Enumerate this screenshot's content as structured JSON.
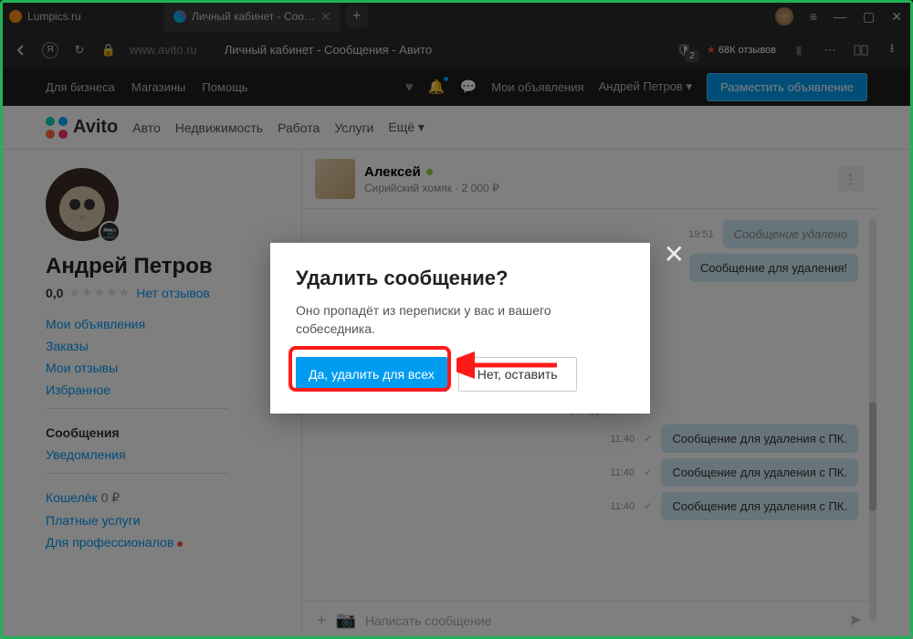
{
  "browser": {
    "tabs": [
      {
        "label": "Lumpics.ru"
      },
      {
        "label": "Личный кабинет - Соо…"
      }
    ],
    "url_domain": "www.avito.ru",
    "url_title": "Личный кабинет - Сообщения - Авито",
    "counter": "2",
    "rating": "68К отзывов"
  },
  "topbar": {
    "business": "Для бизнеса",
    "shops": "Магазины",
    "help": "Помощь",
    "my_ads": "Мои объявления",
    "user": "Андрей Петров",
    "post": "Разместить объявление"
  },
  "nav": {
    "brand": "Avito",
    "links": [
      "Авто",
      "Недвижимость",
      "Работа",
      "Услуги",
      "Ещё"
    ]
  },
  "profile": {
    "name": "Андрей Петров",
    "rating": "0,0",
    "no_reviews": "Нет отзывов",
    "links1": [
      "Мои объявления",
      "Заказы",
      "Мои отзывы",
      "Избранное"
    ],
    "messages": "Сообщения",
    "notifications": "Уведомления",
    "wallet": "Кошелёк",
    "wallet_amt": "0 ₽",
    "paid": "Платные услуги",
    "pro": "Для профессионалов"
  },
  "chat": {
    "name": "Алексей",
    "sub": "Сирийский хомяк · 2 000 ₽",
    "msgs": [
      {
        "time": "19:51",
        "text": "Сообщение удалено",
        "deleted": true
      },
      {
        "time": "",
        "text": "Сообщение для удаления!"
      }
    ],
    "day": "Сегодня",
    "msgs2": [
      {
        "time": "11:40",
        "text": "Сообщение для удаления с ПК."
      },
      {
        "time": "11:40",
        "text": "Сообщение для удаления с ПК."
      },
      {
        "time": "11:40",
        "text": "Сообщение для удаления с ПК."
      }
    ],
    "placeholder": "Написать сообщение"
  },
  "modal": {
    "title": "Удалить сообщение?",
    "text": "Оно пропадёт из переписки у вас и вашего собеседника.",
    "yes": "Да, удалить для всех",
    "no": "Нет, оставить"
  }
}
